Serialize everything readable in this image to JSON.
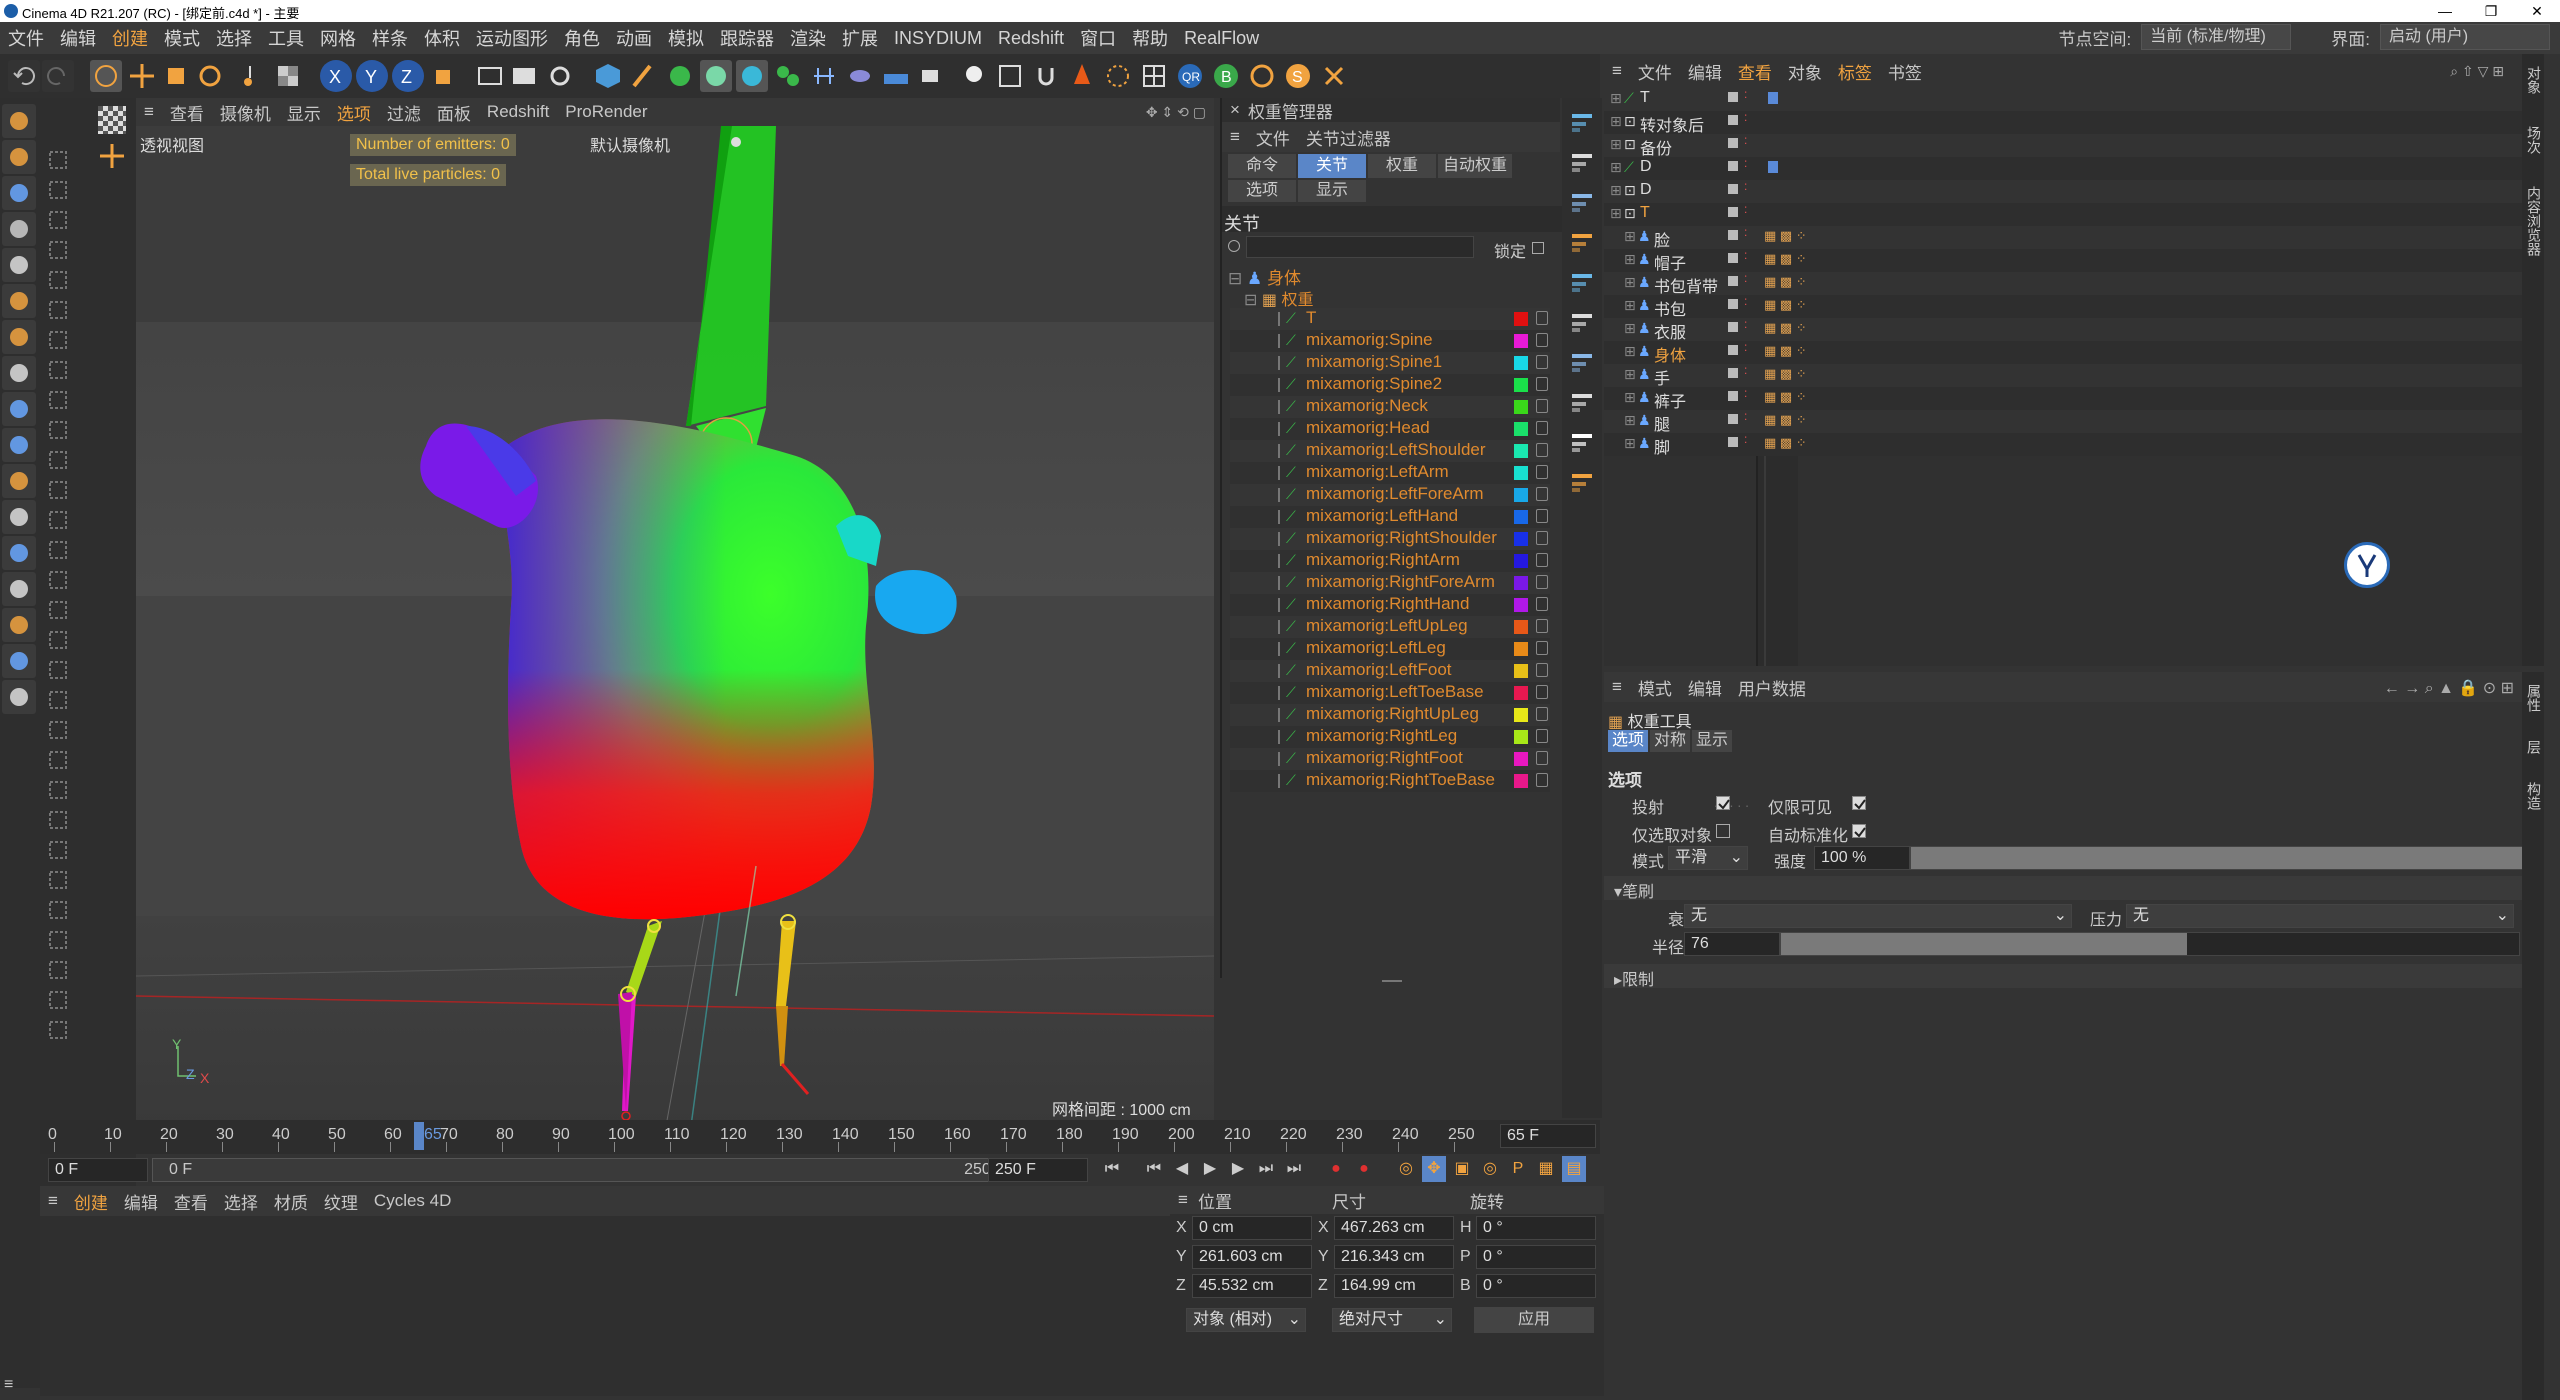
{
  "window": {
    "title": "Cinema 4D R21.207 (RC) - [绑定前.c4d *] - 主要",
    "controls": [
      "—",
      "❐",
      "✕"
    ]
  },
  "menu": {
    "items": [
      "文件",
      "编辑",
      "创建",
      "模式",
      "选择",
      "工具",
      "网格",
      "样条",
      "体积",
      "运动图形",
      "角色",
      "动画",
      "模拟",
      "跟踪器",
      "渲染",
      "扩展",
      "INSYDIUM",
      "Redshift",
      "窗口",
      "帮助",
      "RealFlow"
    ],
    "node_space_label": "节点空间:",
    "node_space_value": "当前 (标准/物理)",
    "layout_label": "界面:",
    "layout_value": "启动 (用户)"
  },
  "viewport": {
    "menu": [
      "查看",
      "摄像机",
      "显示",
      "选项",
      "过滤",
      "面板",
      "Redshift",
      "ProRender"
    ],
    "name": "透视视图",
    "camera": "默认摄像机",
    "hud": [
      "Number of emitters: 0",
      "Total live particles: 0"
    ],
    "grid_label": "网格间距 : 1000 cm",
    "axis_y": "Y",
    "axis_z": "Z",
    "axis_x": "X"
  },
  "weight_manager": {
    "title": "权重管理器",
    "menu": [
      "文件",
      "关节过滤器"
    ],
    "tabs_row1": [
      "命令",
      "关节",
      "权重",
      "自动权重"
    ],
    "tabs_row2": [
      "选项",
      "显示"
    ],
    "section": "关节",
    "lock_label": "锁定",
    "tree_root": "身体",
    "tree_child": "权重",
    "joints": [
      {
        "name": "T",
        "color": "#e01010"
      },
      {
        "name": "mixamorig:Spine",
        "color": "#e81ad6"
      },
      {
        "name": "mixamorig:Spine1",
        "color": "#18d8e8"
      },
      {
        "name": "mixamorig:Spine2",
        "color": "#1ae04a"
      },
      {
        "name": "mixamorig:Neck",
        "color": "#3ad81a"
      },
      {
        "name": "mixamorig:Head",
        "color": "#1ae06a"
      },
      {
        "name": "mixamorig:LeftShoulder",
        "color": "#1ae8b0"
      },
      {
        "name": "mixamorig:LeftArm",
        "color": "#18e0d0"
      },
      {
        "name": "mixamorig:LeftForeArm",
        "color": "#18a8e8"
      },
      {
        "name": "mixamorig:LeftHand",
        "color": "#1868e8"
      },
      {
        "name": "mixamorig:RightShoulder",
        "color": "#1830e8"
      },
      {
        "name": "mixamorig:RightArm",
        "color": "#2418e0"
      },
      {
        "name": "mixamorig:RightForeArm",
        "color": "#7a18e8"
      },
      {
        "name": "mixamorig:RightHand",
        "color": "#b018e8"
      },
      {
        "name": "mixamorig:LeftUpLeg",
        "color": "#e85818"
      },
      {
        "name": "mixamorig:LeftLeg",
        "color": "#e88a18"
      },
      {
        "name": "mixamorig:LeftFoot",
        "color": "#e8c018"
      },
      {
        "name": "mixamorig:LeftToeBase",
        "color": "#e81850"
      },
      {
        "name": "mixamorig:RightUpLeg",
        "color": "#e8e818"
      },
      {
        "name": "mixamorig:RightLeg",
        "color": "#a8e818"
      },
      {
        "name": "mixamorig:RightFoot",
        "color": "#e818c0"
      },
      {
        "name": "mixamorig:RightToeBase",
        "color": "#e8188a"
      }
    ]
  },
  "object_manager": {
    "menu": [
      "文件",
      "编辑",
      "查看",
      "对象",
      "标签",
      "书签"
    ],
    "objects": [
      {
        "name": "T",
        "level": 0,
        "icon": "bone"
      },
      {
        "name": "转对象后",
        "level": 0,
        "icon": "null"
      },
      {
        "name": "备份",
        "level": 0,
        "icon": "null"
      },
      {
        "name": "D",
        "level": 0,
        "icon": "bone"
      },
      {
        "name": "D",
        "level": 0,
        "icon": "null"
      },
      {
        "name": "T",
        "level": 0,
        "icon": "null",
        "orange": true
      },
      {
        "name": "脸",
        "level": 1,
        "icon": "poly"
      },
      {
        "name": "帽子",
        "level": 1,
        "icon": "poly"
      },
      {
        "name": "书包背带",
        "level": 1,
        "icon": "poly"
      },
      {
        "name": "书包",
        "level": 1,
        "icon": "poly"
      },
      {
        "name": "衣服",
        "level": 1,
        "icon": "poly"
      },
      {
        "name": "身体",
        "level": 1,
        "icon": "poly",
        "orange": true
      },
      {
        "name": "手",
        "level": 1,
        "icon": "poly"
      },
      {
        "name": "裤子",
        "level": 1,
        "icon": "poly"
      },
      {
        "name": "腿",
        "level": 1,
        "icon": "poly"
      },
      {
        "name": "脚",
        "level": 1,
        "icon": "poly"
      }
    ],
    "side_tabs": [
      "对象",
      "场次",
      "内容浏览器"
    ]
  },
  "attributes": {
    "menu": [
      "模式",
      "编辑",
      "用户数据"
    ],
    "tool": "权重工具",
    "tabs": [
      "选项",
      "对称",
      "显示"
    ],
    "section": "选项",
    "cast": "投射",
    "visible_only": "仅限可见",
    "selected_only": "仅选取对象",
    "auto_normalize": "自动标准化",
    "mode_label": "模式",
    "mode_value": "平滑",
    "strength_label": "强度",
    "strength_value": "100 %",
    "strength_fill": 1.0,
    "brush_section": "笔刷",
    "falloff_label": "衰减",
    "falloff_value": "无",
    "pressure_label": "压力",
    "pressure_value": "无",
    "radius_label": "半径",
    "radius_value": "76",
    "radius_fill": 0.55,
    "limit_section": "限制",
    "side_tabs": [
      "属性",
      "层",
      "构造"
    ]
  },
  "timeline": {
    "ticks": [
      "0",
      "10",
      "20",
      "30",
      "40",
      "50",
      "60",
      "70",
      "80",
      "90",
      "100",
      "110",
      "120",
      "130",
      "140",
      "150",
      "160",
      "170",
      "180",
      "190",
      "200",
      "210",
      "220",
      "230",
      "240",
      "250"
    ],
    "current_frame_marker": "65",
    "current_frame": "65 F",
    "start": "0 F",
    "start2": "0 F",
    "end": "250 F",
    "end2": "250 F",
    "playhead_fraction": 0.26
  },
  "material": {
    "menu": [
      "创建",
      "编辑",
      "查看",
      "选择",
      "材质",
      "纹理",
      "Cycles 4D"
    ]
  },
  "coordinates": {
    "headers": [
      "位置",
      "尺寸",
      "旋转"
    ],
    "rows": [
      {
        "axis": "X",
        "pos": "0 cm",
        "size_axis": "X",
        "size": "467.263 cm",
        "rot_axis": "H",
        "rot": "0 °"
      },
      {
        "axis": "Y",
        "pos": "261.603 cm",
        "size_axis": "Y",
        "size": "216.343 cm",
        "rot_axis": "P",
        "rot": "0 °"
      },
      {
        "axis": "Z",
        "pos": "45.532 cm",
        "size_axis": "Z",
        "size": "164.99 cm",
        "rot_axis": "B",
        "rot": "0 °"
      }
    ],
    "mode": "对象 (相对)",
    "size_mode": "绝对尺寸",
    "apply": "应用"
  },
  "colors": {
    "accent": "#f1a340",
    "panel": "#333333",
    "bg": "#2b2b2b",
    "highlight": "#5a86c8"
  }
}
